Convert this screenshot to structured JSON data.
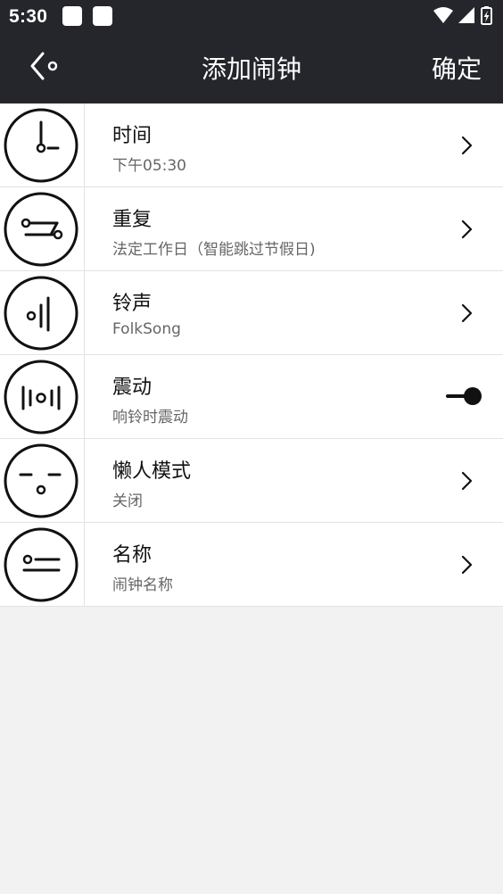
{
  "status_bar": {
    "time": "5:30"
  },
  "header": {
    "title": "添加闹钟",
    "confirm_label": "确定"
  },
  "rows": [
    {
      "title": "时间",
      "subtitle": "下午05:30",
      "icon": "clock-icon",
      "control": "chevron"
    },
    {
      "title": "重复",
      "subtitle": "法定工作日（智能跳过节假日)",
      "icon": "repeat-icon",
      "control": "chevron"
    },
    {
      "title": "铃声",
      "subtitle": "FolkSong",
      "icon": "ringtone-icon",
      "control": "chevron"
    },
    {
      "title": "震动",
      "subtitle": "响铃时震动",
      "icon": "vibrate-icon",
      "control": "toggle",
      "toggle_on": true
    },
    {
      "title": "懒人模式",
      "subtitle": "关闭",
      "icon": "lazy-face-icon",
      "control": "chevron"
    },
    {
      "title": "名称",
      "subtitle": "闹钟名称",
      "icon": "label-icon",
      "control": "chevron"
    }
  ],
  "colors": {
    "header_bg": "#25262b",
    "page_bg": "#f2f2f2",
    "icon_stroke": "#111111"
  }
}
